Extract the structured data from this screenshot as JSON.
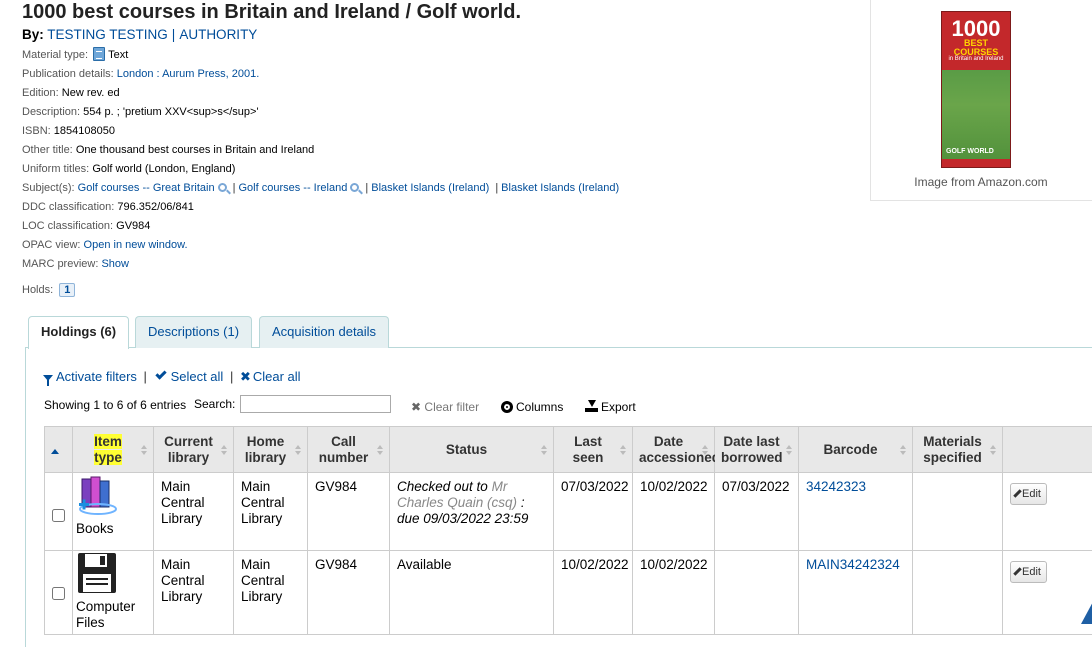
{
  "record": {
    "title": "1000 best courses in Britain and Ireland / Golf world.",
    "by_label": "By:",
    "authors": [
      "TESTING TESTING",
      "AUTHORITY"
    ],
    "author_separator": "|",
    "details": {
      "material_type_label": "Material type:",
      "material_type_value": "Text",
      "publication_label": "Publication details:",
      "publication_value": "London : Aurum Press, 2001.",
      "edition_label": "Edition:",
      "edition_value": "New rev. ed",
      "description_label": "Description:",
      "description_value": "554 p. ; 'pretium XXV<sup>s</sup>'",
      "isbn_label": "ISBN:",
      "isbn_value": "1854108050",
      "other_title_label": "Other title:",
      "other_title_value": "One thousand best courses in Britain and Ireland",
      "uniform_titles_label": "Uniform titles:",
      "uniform_titles_value": "Golf world (London, England)",
      "subjects_label": "Subject(s):",
      "subjects": [
        "Golf courses -- Great Britain",
        "Golf courses -- Ireland",
        "Blasket Islands (Ireland)",
        "Blasket Islands (Ireland)"
      ],
      "subject_separator": "|",
      "ddc_label": "DDC classification:",
      "ddc_value": "796.352/06/841",
      "loc_label": "LOC classification:",
      "loc_value": "GV984",
      "opac_label": "OPAC view:",
      "opac_value": "Open in new window.",
      "marc_label": "MARC preview:",
      "marc_value": "Show"
    },
    "holds_label": "Holds:",
    "holds_count": "1"
  },
  "cover": {
    "big_text": "1000",
    "sub_text": "BEST COURSES",
    "sub2_text": "in Britain and Ireland",
    "logo_text": "GOLF WORLD",
    "caption": "Image from Amazon.com"
  },
  "tabs": [
    {
      "label": "Holdings (6)",
      "active": true
    },
    {
      "label": "Descriptions (1)",
      "active": false
    },
    {
      "label": "Acquisition details",
      "active": false
    }
  ],
  "toolbar": {
    "activate_filters": "Activate filters",
    "select_all": "Select all",
    "clear_all": "Clear all",
    "separator": "|",
    "showing": "Showing 1 to 6 of 6 entries",
    "search_label": "Search:",
    "search_value": "",
    "clear_filter": "Clear filter",
    "columns": "Columns",
    "export": "Export"
  },
  "table": {
    "headers": {
      "item_type_1": "Item",
      "item_type_2": "type",
      "current_library": "Current library",
      "home_library": "Home library",
      "call_number": "Call number",
      "status": "Status",
      "last_seen": "Last seen",
      "date_accessioned": "Date accessioned",
      "date_last_borrowed": "Date last borrowed",
      "barcode": "Barcode",
      "materials_specified": "Materials specified"
    },
    "rows": [
      {
        "item_type": "Books",
        "item_icon": "books-icon",
        "current_library": "Main Central Library",
        "home_library": "Main Central Library",
        "call_number": "GV984",
        "status_prefix": "Checked out to",
        "status_patron": "Mr Charles Quain (csq)",
        "status_suffix": ": due 09/03/2022 23:59",
        "last_seen": "07/03/2022",
        "date_accessioned": "10/02/2022",
        "date_last_borrowed": "07/03/2022",
        "barcode": "34242323",
        "materials_specified": "",
        "edit_label": "Edit"
      },
      {
        "item_type": "Computer Files",
        "item_icon": "floppy-disk-icon",
        "current_library": "Main Central Library",
        "home_library": "Main Central Library",
        "call_number": "GV984",
        "status": "Available",
        "last_seen": "10/02/2022",
        "date_accessioned": "10/02/2022",
        "date_last_borrowed": "",
        "barcode": "MAIN34242324",
        "materials_specified": "",
        "edit_label": "Edit"
      }
    ]
  },
  "colors": {
    "link": "#004d99",
    "highlight": "#ffff33",
    "header_bg": "#e8e8e8",
    "tab_border": "#b9d8d9"
  }
}
